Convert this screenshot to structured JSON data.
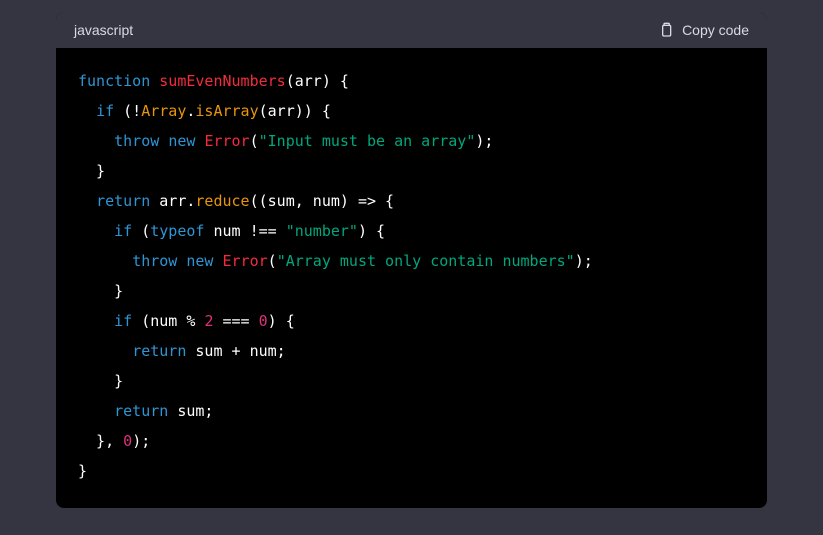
{
  "header": {
    "language": "javascript",
    "copy_label": "Copy code"
  },
  "code": {
    "tokens": [
      {
        "c": "tok-kw",
        "t": "function"
      },
      {
        "c": "tok-id",
        "t": " "
      },
      {
        "c": "tok-fn",
        "t": "sumEvenNumbers"
      },
      {
        "c": "tok-id",
        "t": "(arr) {"
      },
      {
        "nl": true
      },
      {
        "c": "tok-id",
        "t": "  "
      },
      {
        "c": "tok-kw",
        "t": "if"
      },
      {
        "c": "tok-id",
        "t": " (!"
      },
      {
        "c": "tok-prop",
        "t": "Array"
      },
      {
        "c": "tok-id",
        "t": "."
      },
      {
        "c": "tok-prop",
        "t": "isArray"
      },
      {
        "c": "tok-id",
        "t": "(arr)) {"
      },
      {
        "nl": true
      },
      {
        "c": "tok-id",
        "t": "    "
      },
      {
        "c": "tok-kw",
        "t": "throw"
      },
      {
        "c": "tok-id",
        "t": " "
      },
      {
        "c": "tok-kw",
        "t": "new"
      },
      {
        "c": "tok-id",
        "t": " "
      },
      {
        "c": "tok-fn",
        "t": "Error"
      },
      {
        "c": "tok-id",
        "t": "("
      },
      {
        "c": "tok-str",
        "t": "\"Input must be an array\""
      },
      {
        "c": "tok-id",
        "t": ");"
      },
      {
        "nl": true
      },
      {
        "c": "tok-id",
        "t": "  }"
      },
      {
        "nl": true
      },
      {
        "c": "tok-id",
        "t": "  "
      },
      {
        "c": "tok-kw",
        "t": "return"
      },
      {
        "c": "tok-id",
        "t": " arr."
      },
      {
        "c": "tok-prop",
        "t": "reduce"
      },
      {
        "c": "tok-id",
        "t": "((sum, num) => {"
      },
      {
        "nl": true
      },
      {
        "c": "tok-id",
        "t": "    "
      },
      {
        "c": "tok-kw",
        "t": "if"
      },
      {
        "c": "tok-id",
        "t": " ("
      },
      {
        "c": "tok-kw",
        "t": "typeof"
      },
      {
        "c": "tok-id",
        "t": " num !== "
      },
      {
        "c": "tok-str",
        "t": "\"number\""
      },
      {
        "c": "tok-id",
        "t": ") {"
      },
      {
        "nl": true
      },
      {
        "c": "tok-id",
        "t": "      "
      },
      {
        "c": "tok-kw",
        "t": "throw"
      },
      {
        "c": "tok-id",
        "t": " "
      },
      {
        "c": "tok-kw",
        "t": "new"
      },
      {
        "c": "tok-id",
        "t": " "
      },
      {
        "c": "tok-fn",
        "t": "Error"
      },
      {
        "c": "tok-id",
        "t": "("
      },
      {
        "c": "tok-str",
        "t": "\"Array must only contain numbers\""
      },
      {
        "c": "tok-id",
        "t": ");"
      },
      {
        "nl": true
      },
      {
        "c": "tok-id",
        "t": "    }"
      },
      {
        "nl": true
      },
      {
        "c": "tok-id",
        "t": "    "
      },
      {
        "c": "tok-kw",
        "t": "if"
      },
      {
        "c": "tok-id",
        "t": " (num % "
      },
      {
        "c": "tok-num",
        "t": "2"
      },
      {
        "c": "tok-id",
        "t": " === "
      },
      {
        "c": "tok-num",
        "t": "0"
      },
      {
        "c": "tok-id",
        "t": ") {"
      },
      {
        "nl": true
      },
      {
        "c": "tok-id",
        "t": "      "
      },
      {
        "c": "tok-kw",
        "t": "return"
      },
      {
        "c": "tok-id",
        "t": " sum + num;"
      },
      {
        "nl": true
      },
      {
        "c": "tok-id",
        "t": "    }"
      },
      {
        "nl": true
      },
      {
        "c": "tok-id",
        "t": "    "
      },
      {
        "c": "tok-kw",
        "t": "return"
      },
      {
        "c": "tok-id",
        "t": " sum;"
      },
      {
        "nl": true
      },
      {
        "c": "tok-id",
        "t": "  }, "
      },
      {
        "c": "tok-num",
        "t": "0"
      },
      {
        "c": "tok-id",
        "t": ");"
      },
      {
        "nl": true
      },
      {
        "c": "tok-id",
        "t": "}"
      }
    ]
  }
}
